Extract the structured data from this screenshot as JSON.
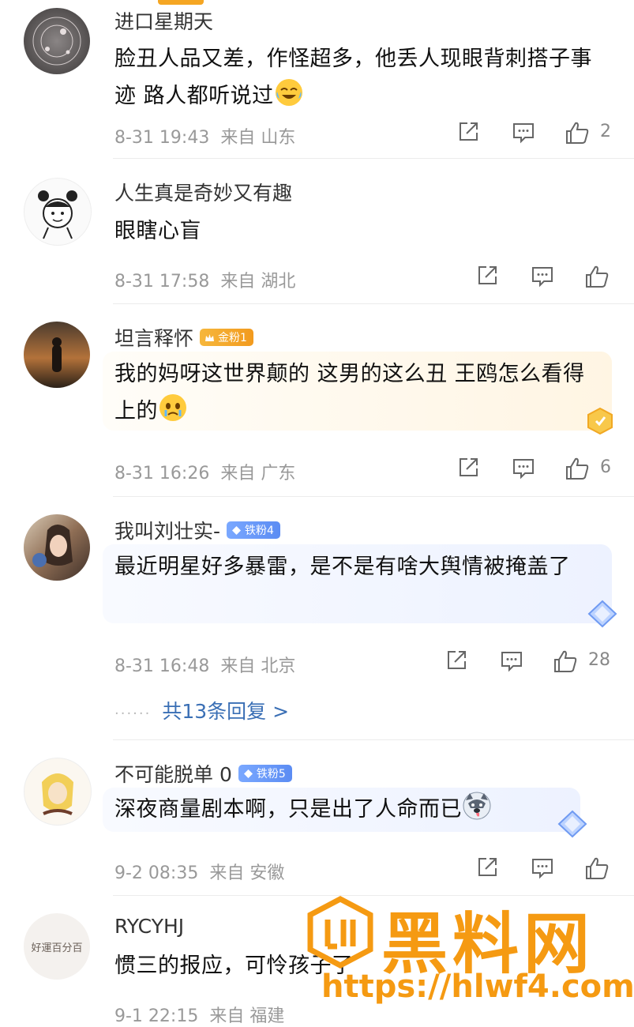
{
  "comments": [
    {
      "user": "进口星期天",
      "badge": null,
      "text": "脸丑人品又差，作怪超多，他丢人现眼背刺搭子事迹 路人都听说过",
      "time": "8-31 19:43",
      "from": "来自 山东",
      "likes": "2"
    },
    {
      "user": "人生真是奇妙又有趣",
      "badge": null,
      "text": "眼瞎心盲",
      "time": "8-31 17:58",
      "from": "来自 湖北",
      "likes": ""
    },
    {
      "user": "坦言释怀",
      "badge": "金粉1",
      "text": "我的妈呀这世界颠的 这男的这么丑 王鸥怎么看得上的",
      "time": "8-31 16:26",
      "from": "来自 广东",
      "likes": "6"
    },
    {
      "user": "我叫刘壮实-",
      "badge": "铁粉4",
      "text": "最近明星好多暴雷，是不是有啥大舆情被掩盖了",
      "time": "8-31 16:48",
      "from": "来自 北京",
      "likes": "28",
      "replies": "共13条回复 >"
    },
    {
      "user": "不可能脱单 0",
      "badge": "铁粉5",
      "text": "深夜商量剧本啊，只是出了人命而已",
      "time": "9-2 08:35",
      "from": "来自 安徽",
      "likes": ""
    },
    {
      "user": "RYCYHJ",
      "badge": null,
      "text": "惯三的报应，可怜孩子了",
      "time": "9-1 22:15",
      "from": "来自 福建",
      "likes": "",
      "avatar_text": "好運百分百"
    }
  ],
  "watermark": {
    "brand": "黑料网",
    "url": "https://hlwf4.com"
  },
  "colors": {
    "gold_badge": "#f4a62a",
    "iron_badge": "#6b9af7",
    "reply_link": "#3a6fb5",
    "watermark": "#f59a12"
  },
  "icons": [
    "share-icon",
    "comment-icon",
    "like-icon"
  ]
}
